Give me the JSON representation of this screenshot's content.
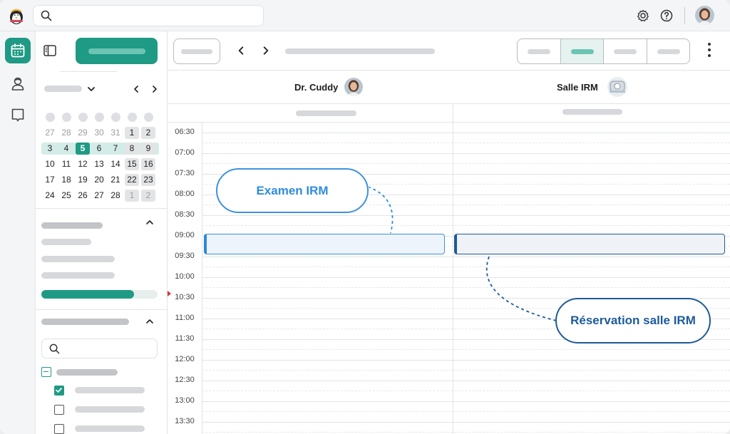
{
  "calendar": {
    "rows": [
      [
        "27",
        "28",
        "29",
        "30",
        "31",
        "1",
        "2"
      ],
      [
        "3",
        "4",
        "5",
        "6",
        "7",
        "8",
        "9"
      ],
      [
        "10",
        "11",
        "12",
        "13",
        "14",
        "15",
        "16"
      ],
      [
        "17",
        "18",
        "19",
        "20",
        "21",
        "22",
        "23"
      ],
      [
        "24",
        "25",
        "26",
        "27",
        "28",
        "1",
        "2"
      ]
    ],
    "today": "5"
  },
  "agenda": {
    "progress": 0.8
  },
  "columns": [
    {
      "name": "Dr. Cuddy",
      "avatar": "doctor-avatar"
    },
    {
      "name": "Salle IRM",
      "avatar": "mri-machine-icon"
    }
  ],
  "times": [
    "06:30",
    "07:00",
    "07:30",
    "08:00",
    "08:30",
    "09:00",
    "09:30",
    "10:00",
    "10:30",
    "11:00",
    "11:30",
    "12:00",
    "12:30",
    "13:00",
    "13:30"
  ],
  "callouts": {
    "exam": "Examen IRM",
    "room": "Réservation salle IRM"
  },
  "colors": {
    "accent": "#1f9a84",
    "event_blue": "#2b88dc",
    "event_navy": "#1d5a99",
    "now_marker": "#e0333b"
  },
  "icons": [
    "search-icon",
    "settings-icon",
    "help-icon",
    "calendar-icon",
    "patient-icon",
    "bookmark-icon",
    "sidebar-toggle-icon",
    "chevron-left-icon",
    "chevron-right-icon",
    "chevron-down-icon",
    "chevron-up-icon",
    "more-vertical-icon"
  ]
}
